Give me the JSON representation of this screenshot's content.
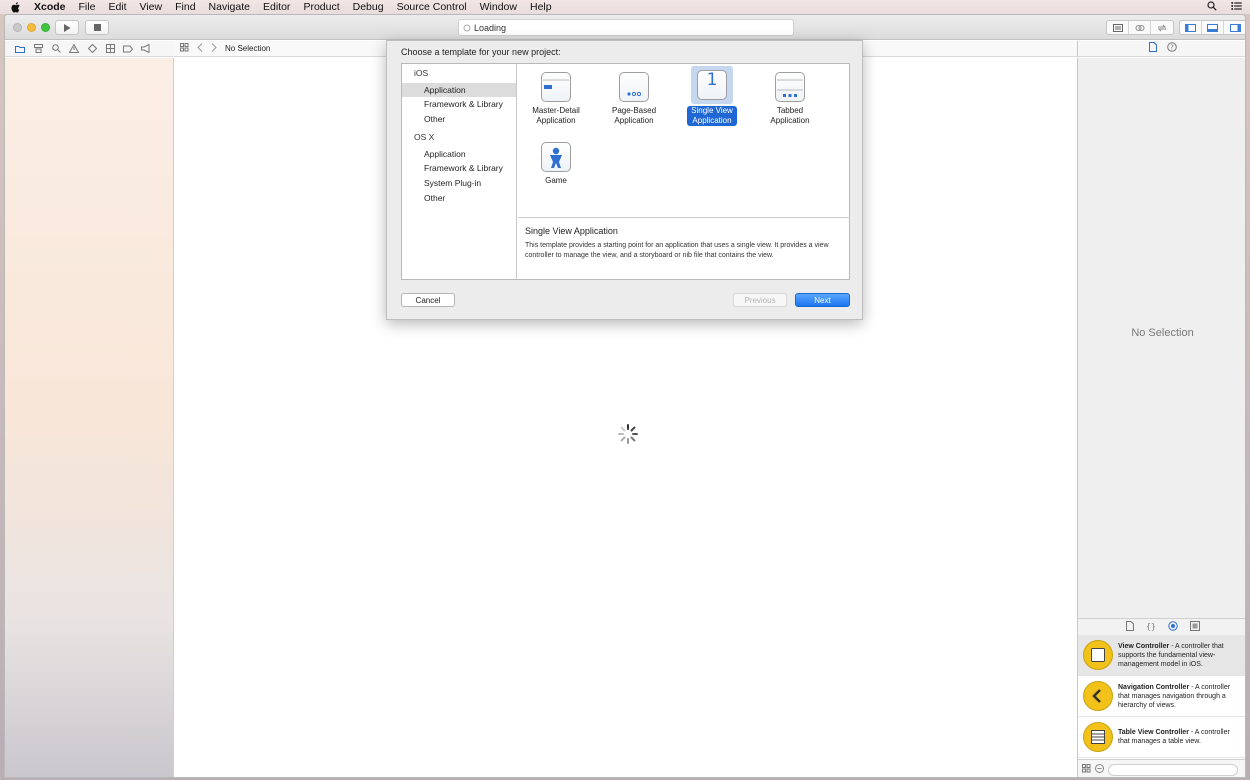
{
  "menubar": {
    "app": "Xcode",
    "items": [
      "File",
      "Edit",
      "View",
      "Find",
      "Navigate",
      "Editor",
      "Product",
      "Debug",
      "Source Control",
      "Window",
      "Help"
    ]
  },
  "toolbar": {
    "activity": "Loading"
  },
  "jumpbar": {
    "selection": "No Selection"
  },
  "inspector": {
    "empty": "No Selection"
  },
  "library": {
    "items": [
      {
        "title": "View Controller",
        "desc": " - A controller that supports the fundamental view-management model in iOS."
      },
      {
        "title": "Navigation Controller",
        "desc": " - A controller that manages navigation through a hierarchy of views."
      },
      {
        "title": "Table View Controller",
        "desc": " - A controller that manages a table view."
      }
    ]
  },
  "dialog": {
    "title": "Choose a template for your new project:",
    "categories": {
      "ios": "iOS",
      "ios_items": [
        "Application",
        "Framework & Library",
        "Other"
      ],
      "osx": "OS X",
      "osx_items": [
        "Application",
        "Framework & Library",
        "System Plug-in",
        "Other"
      ]
    },
    "templates": [
      {
        "line1": "Master-Detail",
        "line2": "Application"
      },
      {
        "line1": "Page-Based",
        "line2": "Application"
      },
      {
        "line1": "Single View",
        "line2": "Application"
      },
      {
        "line1": "Tabbed",
        "line2": "Application"
      },
      {
        "line1": "Game",
        "line2": ""
      }
    ],
    "selected_icon_text": "1",
    "description_title": "Single View Application",
    "description": "This template provides a starting point for an application that uses a single view. It provides a view controller to manage the view, and a storyboard or nib file that contains the view.",
    "buttons": {
      "cancel": "Cancel",
      "previous": "Previous",
      "next": "Next"
    }
  },
  "colors": {
    "accent": "#2067d6",
    "library_icon": "#f2c21b"
  }
}
